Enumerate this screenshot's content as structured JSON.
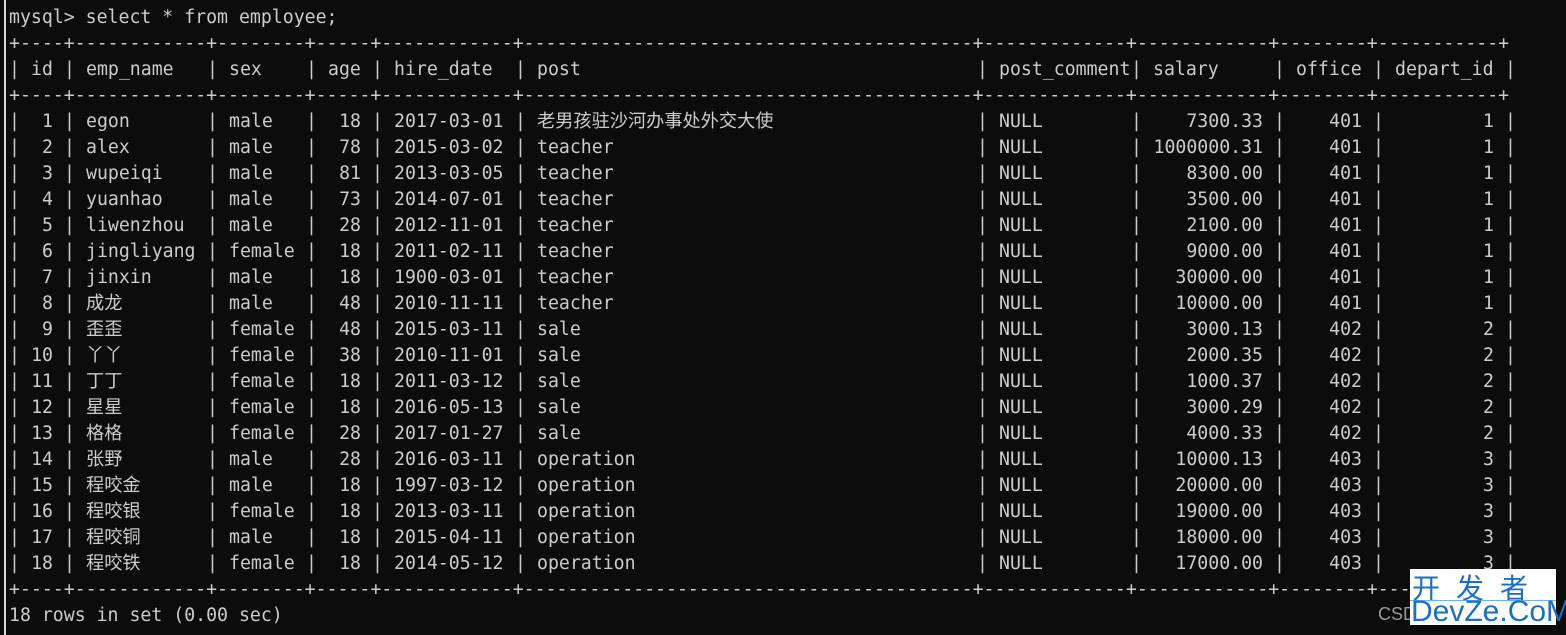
{
  "terminal": {
    "command": "mysql> select * from employee;",
    "footer": "18 rows in set (0.00 sec)",
    "text_color": "#cccccc",
    "background": "#0c0c0c"
  },
  "table": {
    "columns": [
      "id",
      "emp_name",
      "sex",
      "age",
      "hire_date",
      "post",
      "post_comment",
      "salary",
      "office",
      "depart_id"
    ],
    "rows": [
      [
        "1",
        "egon",
        "male",
        "18",
        "2017-03-01",
        "老男孩驻沙河办事处外交大使",
        "NULL",
        "7300.33",
        "401",
        "1"
      ],
      [
        "2",
        "alex",
        "male",
        "78",
        "2015-03-02",
        "teacher",
        "NULL",
        "1000000.31",
        "401",
        "1"
      ],
      [
        "3",
        "wupeiqi",
        "male",
        "81",
        "2013-03-05",
        "teacher",
        "NULL",
        "8300.00",
        "401",
        "1"
      ],
      [
        "4",
        "yuanhao",
        "male",
        "73",
        "2014-07-01",
        "teacher",
        "NULL",
        "3500.00",
        "401",
        "1"
      ],
      [
        "5",
        "liwenzhou",
        "male",
        "28",
        "2012-11-01",
        "teacher",
        "NULL",
        "2100.00",
        "401",
        "1"
      ],
      [
        "6",
        "jingliyang",
        "female",
        "18",
        "2011-02-11",
        "teacher",
        "NULL",
        "9000.00",
        "401",
        "1"
      ],
      [
        "7",
        "jinxin",
        "male",
        "18",
        "1900-03-01",
        "teacher",
        "NULL",
        "30000.00",
        "401",
        "1"
      ],
      [
        "8",
        "成龙",
        "male",
        "48",
        "2010-11-11",
        "teacher",
        "NULL",
        "10000.00",
        "401",
        "1"
      ],
      [
        "9",
        "歪歪",
        "female",
        "48",
        "2015-03-11",
        "sale",
        "NULL",
        "3000.13",
        "402",
        "2"
      ],
      [
        "10",
        "丫丫",
        "female",
        "38",
        "2010-11-01",
        "sale",
        "NULL",
        "2000.35",
        "402",
        "2"
      ],
      [
        "11",
        "丁丁",
        "female",
        "18",
        "2011-03-12",
        "sale",
        "NULL",
        "1000.37",
        "402",
        "2"
      ],
      [
        "12",
        "星星",
        "female",
        "18",
        "2016-05-13",
        "sale",
        "NULL",
        "3000.29",
        "402",
        "2"
      ],
      [
        "13",
        "格格",
        "female",
        "28",
        "2017-01-27",
        "sale",
        "NULL",
        "4000.33",
        "402",
        "2"
      ],
      [
        "14",
        "张野",
        "male",
        "28",
        "2016-03-11",
        "operation",
        "NULL",
        "10000.13",
        "403",
        "3"
      ],
      [
        "15",
        "程咬金",
        "male",
        "18",
        "1997-03-12",
        "operation",
        "NULL",
        "20000.00",
        "403",
        "3"
      ],
      [
        "16",
        "程咬银",
        "female",
        "18",
        "2013-03-11",
        "operation",
        "NULL",
        "19000.00",
        "403",
        "3"
      ],
      [
        "17",
        "程咬铜",
        "male",
        "18",
        "2015-04-11",
        "operation",
        "NULL",
        "18000.00",
        "403",
        "3"
      ],
      [
        "18",
        "程咬铁",
        "female",
        "18",
        "2014-05-12",
        "operation",
        "NULL",
        "17000.00",
        "403",
        "3"
      ]
    ]
  },
  "watermark": {
    "logo_top": "开发者",
    "logo_bottom": "DevZe.CoM",
    "partial_text": "CSD",
    "color": "#1a6fc0"
  }
}
